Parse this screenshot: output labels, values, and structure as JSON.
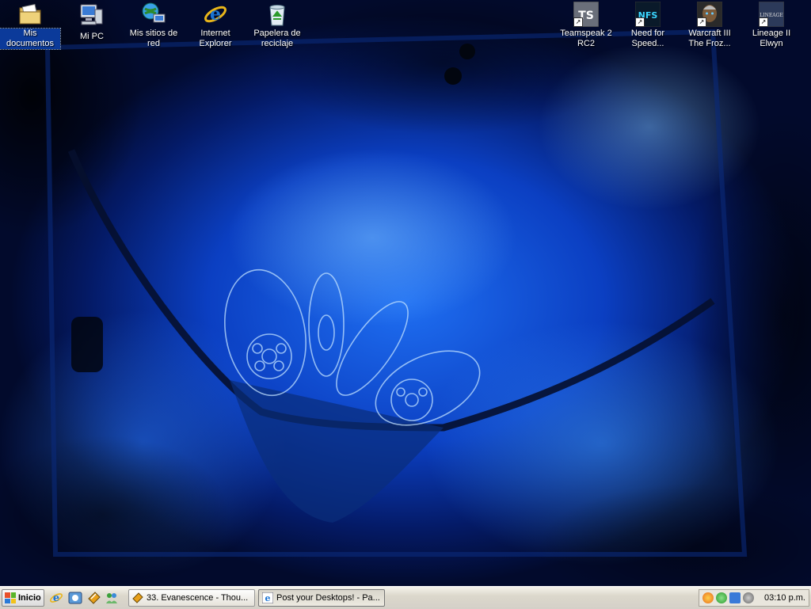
{
  "desktop": {
    "icons_left": [
      {
        "label": "Mis documentos",
        "icon": "my-documents-icon",
        "selected": true
      },
      {
        "label": "Mi PC",
        "icon": "my-computer-icon"
      },
      {
        "label": "Mis sitios de red",
        "icon": "network-places-icon"
      },
      {
        "label": "Internet Explorer",
        "icon": "internet-explorer-icon"
      },
      {
        "label": "Papelera de reciclaje",
        "icon": "recycle-bin-icon"
      }
    ],
    "icons_right": [
      {
        "label": "Teamspeak 2 RC2",
        "icon": "teamspeak-icon",
        "badge": "TS"
      },
      {
        "label": "Need for Speed...",
        "icon": "need-for-speed-icon",
        "badge": "NFS"
      },
      {
        "label": "Warcraft III The Froz...",
        "icon": "warcraft-icon"
      },
      {
        "label": "Lineage II Elwyn",
        "icon": "lineage-icon",
        "badge": "LINEAGE"
      }
    ]
  },
  "taskbar": {
    "start_label": "Inicio",
    "quick_launch": [
      "internet-explorer-icon",
      "outlook-express-icon",
      "winamp-icon",
      "messenger-icon"
    ],
    "tasks": [
      {
        "label": "33. Evanescence - Thou...",
        "icon": "winamp-icon",
        "active": false
      },
      {
        "label": "Post your Desktops! - Pa...",
        "icon": "internet-explorer-icon",
        "active": true
      }
    ],
    "tray_icons": [
      "firefox-icon",
      "msn-icon",
      "network-icon",
      "speaker-icon"
    ],
    "clock": "03:10 p.m."
  },
  "colors": {
    "wallpaper_blue": "#0b3fc2",
    "selection": "#0b3a9a",
    "taskbar": "#d4d0c8"
  }
}
